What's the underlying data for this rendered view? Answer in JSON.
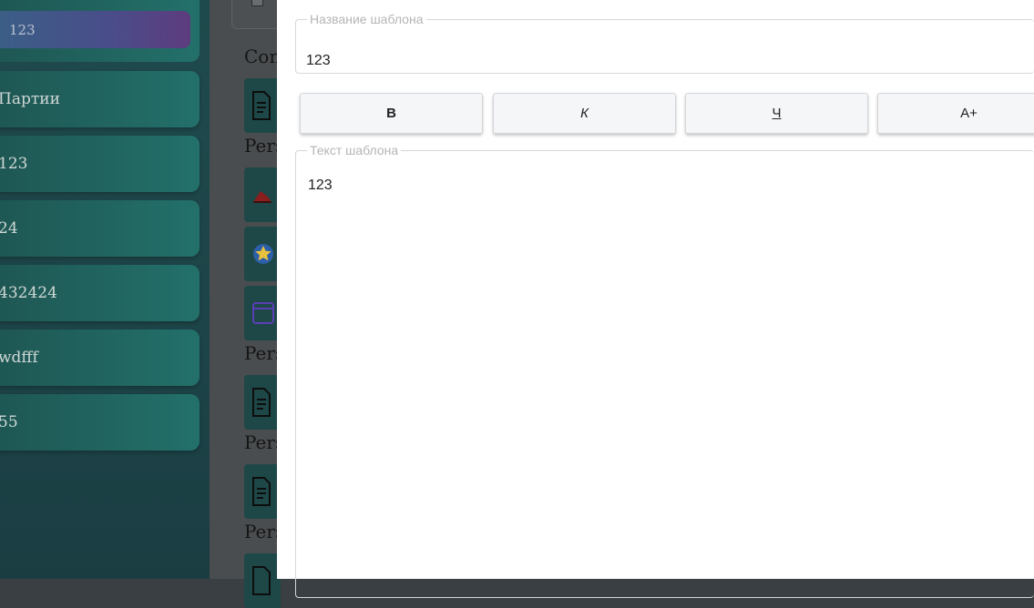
{
  "sidebar": {
    "active_item": "123",
    "items": [
      {
        "label": "Партии"
      },
      {
        "label": "123"
      },
      {
        "label": "24"
      },
      {
        "label": "432424"
      },
      {
        "label": "wdfff"
      },
      {
        "label": "55"
      }
    ]
  },
  "middle": {
    "headings": [
      "Con",
      "Pers",
      "Pers",
      "Pers",
      "Pers"
    ]
  },
  "modal": {
    "title_legend": "Название шаблона",
    "title_value": "123",
    "toolbar": {
      "bold_label": "В",
      "italic_label": "К",
      "underline_label": "Ч",
      "size_label": "А+"
    },
    "text_legend": "Текст шаблона",
    "text_value": "123"
  },
  "colors": {
    "sidebar_bg": "#1f4a4d",
    "sidebar_item": "#23706a",
    "active_item_start": "#3a5f86",
    "active_item_end": "#5d3c7e",
    "modal_bg": "#ffffff"
  }
}
